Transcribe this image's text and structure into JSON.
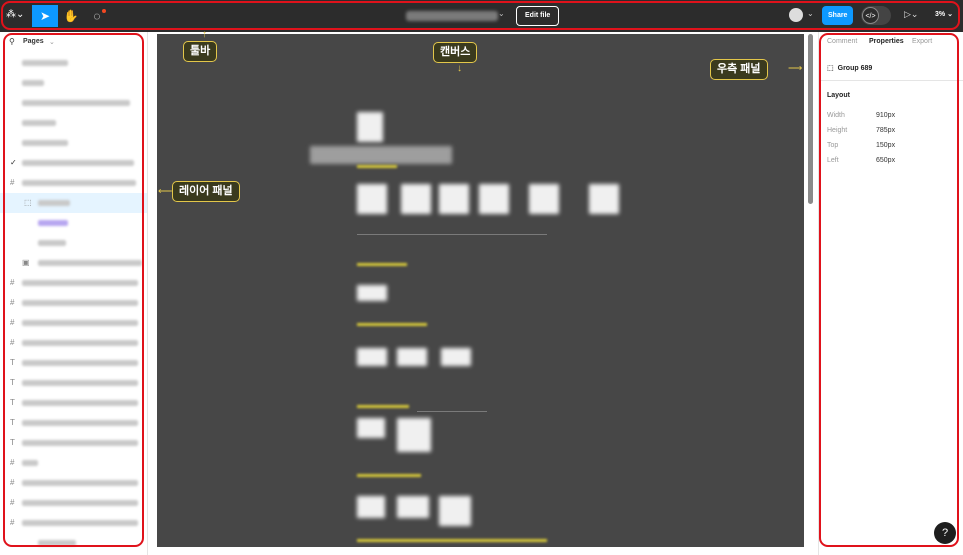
{
  "toolbar": {
    "edit_label": "Edit file",
    "share_label": "Share",
    "zoom": "3%",
    "dev_mode_label": "</>"
  },
  "left_panel": {
    "pages_label": "Pages"
  },
  "right_panel": {
    "tabs": [
      "Comment",
      "Properties",
      "Export"
    ],
    "active_tab": "Properties",
    "selection_name": "Group 689",
    "layout_label": "Layout",
    "props": [
      {
        "key": "Width",
        "value": "910px"
      },
      {
        "key": "Height",
        "value": "785px"
      },
      {
        "key": "Top",
        "value": "150px"
      },
      {
        "key": "Left",
        "value": "650px"
      }
    ]
  },
  "annotations": {
    "toolbar": "툴바",
    "canvas": "캔버스",
    "right_panel": "우측 패널",
    "layer_panel": "레이어 패널"
  },
  "help_label": "?",
  "colors": {
    "accent": "#0d99ff",
    "toolbar_bg": "#2c2c2c",
    "canvas_bg": "#474747",
    "annotation_red": "#e0121b",
    "callout_border": "#e3c74a"
  }
}
